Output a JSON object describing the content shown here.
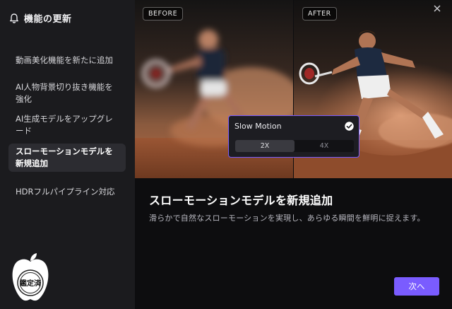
{
  "sidebar": {
    "title": "機能の更新",
    "items": [
      {
        "label": "動画美化機能を新たに追加"
      },
      {
        "label": "AI人物背景切り抜き機能を強化"
      },
      {
        "label": "AI生成モデルをアップグレード"
      },
      {
        "label": "スローモーションモデルを新規追加",
        "active": true
      },
      {
        "label": "HDRフルパイプライン対応"
      }
    ]
  },
  "preview": {
    "before_label": "BEFORE",
    "after_label": "AFTER"
  },
  "slow_motion": {
    "title": "Slow Motion",
    "options": [
      "2X",
      "4X"
    ],
    "selected": "2X"
  },
  "content": {
    "title": "スローモーションモデルを新規追加",
    "description": "滑らかで自然なスローモーションを実現し、あらゆる瞬間を鮮明に捉えます。"
  },
  "footer": {
    "next_label": "次へ"
  },
  "badge": {
    "text": "鑑定済"
  },
  "colors": {
    "accent": "#7a5cff",
    "sidebar_bg": "#1b1b1e",
    "background": "#0d0d0f"
  }
}
